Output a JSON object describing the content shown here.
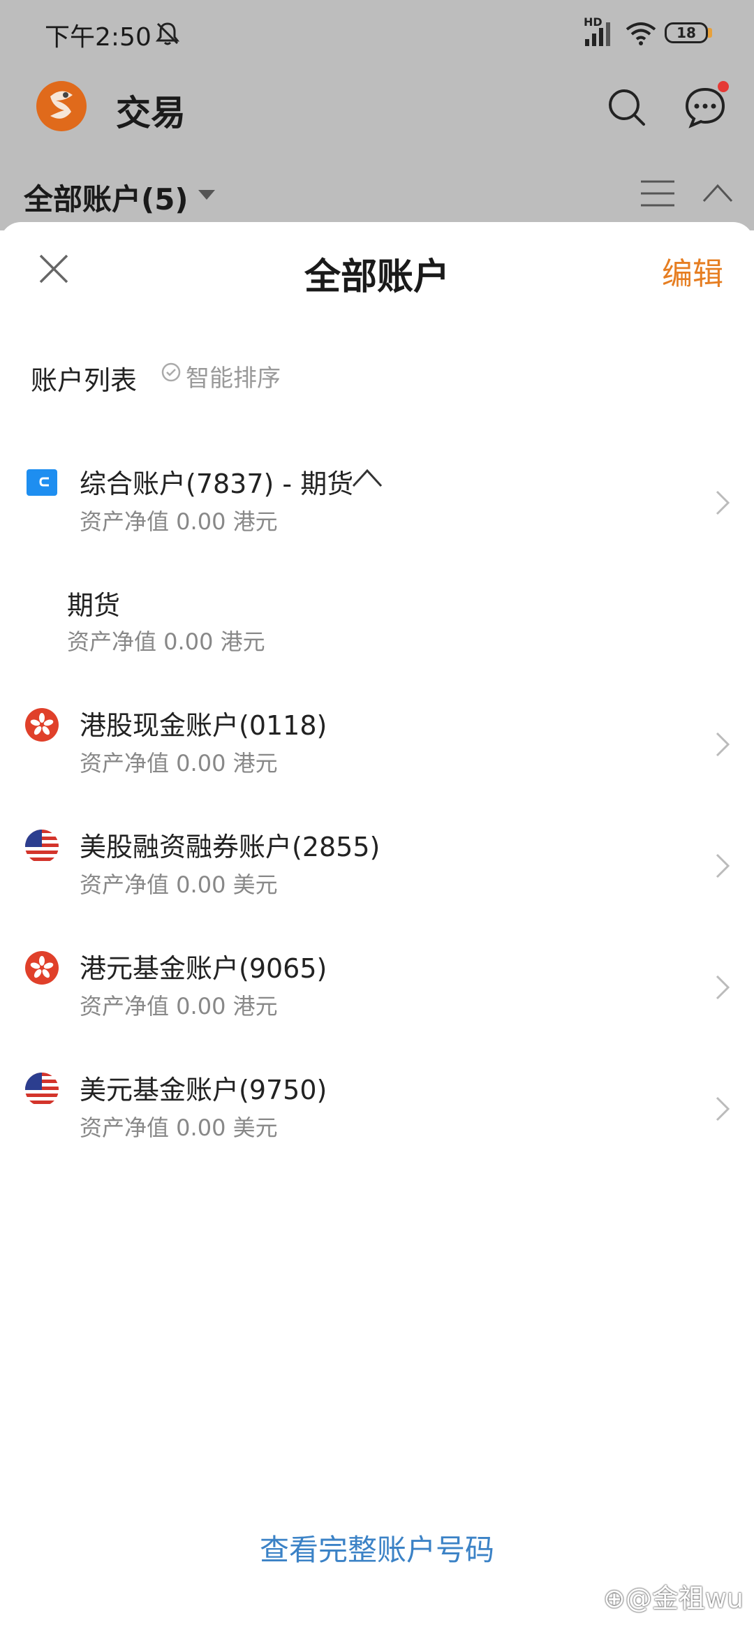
{
  "status_bar": {
    "time": "下午2:50",
    "signal_label": "HD",
    "battery": "18"
  },
  "app_bar": {
    "title": "交易"
  },
  "account_bar": {
    "title": "全部账户(5)"
  },
  "sheet": {
    "title": "全部账户",
    "edit_label": "编辑",
    "list_label": "账户列表",
    "smart_sort_label": "智能排序",
    "accounts": [
      {
        "name": "综合账户(7837) - 期货",
        "value": "资产净值 0.00 港元",
        "icon": "blue-wallet-icon"
      },
      {
        "name": "期货",
        "value": "资产净值 0.00 港元",
        "icon": ""
      },
      {
        "name": "港股现金账户(0118)",
        "value": "资产净值 0.00 港元",
        "icon": "hk-flag-icon"
      },
      {
        "name": "美股融资融券账户(2855)",
        "value": "资产净值 0.00 美元",
        "icon": "us-flag-icon"
      },
      {
        "name": "港元基金账户(9065)",
        "value": "资产净值 0.00 港元",
        "icon": "hk-flag-icon"
      },
      {
        "name": "美元基金账户(9750)",
        "value": "资产净值 0.00 美元",
        "icon": "us-flag-icon"
      }
    ],
    "footer_link": "查看完整账户号码"
  },
  "watermark": "⊕@金祖wu",
  "colors": {
    "accent_orange": "#e67e22",
    "link_blue": "#3b82c6",
    "hk_red": "#e0402a",
    "wallet_blue": "#1e8ef0"
  }
}
